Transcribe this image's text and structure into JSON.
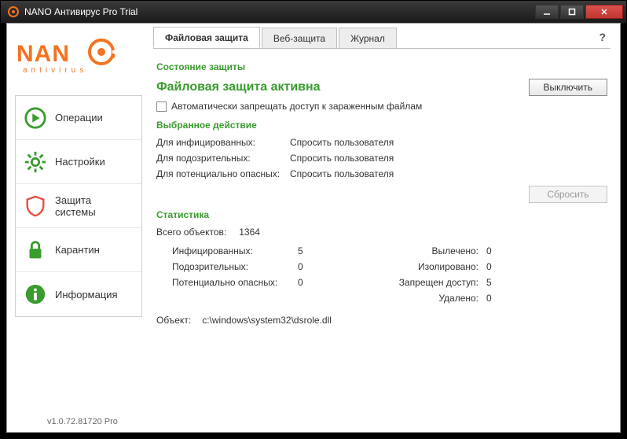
{
  "window": {
    "title": "NANO Антивирус Pro Trial"
  },
  "logo": {
    "top": "NANO",
    "bottom": "antivirus"
  },
  "sidebar": {
    "items": [
      {
        "label": "Операции"
      },
      {
        "label": "Настройки"
      },
      {
        "label": "Защита системы"
      },
      {
        "label": "Карантин"
      },
      {
        "label": "Информация"
      }
    ]
  },
  "version": "v1.0.72.81720 Pro",
  "tabs": [
    {
      "label": "Файловая защита"
    },
    {
      "label": "Веб-защита"
    },
    {
      "label": "Журнал"
    }
  ],
  "help": "?",
  "protection": {
    "section": "Состояние защиты",
    "status": "Файловая защита активна",
    "disable_btn": "Выключить",
    "checkbox_label": "Автоматически запрещать доступ к зараженным файлам"
  },
  "actions": {
    "section": "Выбранное действие",
    "rows": [
      {
        "k": "Для инфицированных:",
        "v": "Спросить пользователя"
      },
      {
        "k": "Для подозрительных:",
        "v": "Спросить пользователя"
      },
      {
        "k": "Для потенциально опасных:",
        "v": "Спросить пользователя"
      }
    ],
    "reset_btn": "Сбросить"
  },
  "stats": {
    "section": "Статистика",
    "total_label": "Всего объектов:",
    "total_value": "1364",
    "left": [
      {
        "k": "Инфицированных:",
        "v": "5"
      },
      {
        "k": "Подозрительных:",
        "v": "0"
      },
      {
        "k": "Потенциально опасных:",
        "v": "0"
      }
    ],
    "right": [
      {
        "k": "Вылечено:",
        "v": "0"
      },
      {
        "k": "Изолировано:",
        "v": "0"
      },
      {
        "k": "Запрещен доступ:",
        "v": "5"
      },
      {
        "k": "Удалено:",
        "v": "0"
      }
    ],
    "object_label": "Объект:",
    "object_value": "c:\\windows\\system32\\dsrole.dll"
  },
  "colors": {
    "accent": "#f37321",
    "green": "#3a9b2e"
  }
}
